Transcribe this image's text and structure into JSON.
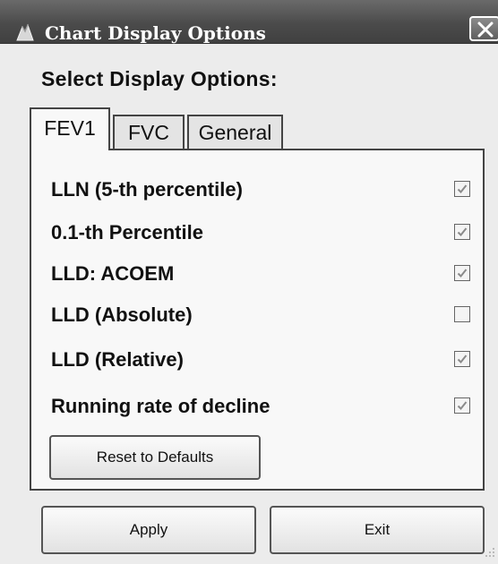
{
  "window": {
    "title": "Chart Display Options",
    "icon": "app-icon",
    "close_icon": "close-icon"
  },
  "heading": "Select Display Options:",
  "tabs": [
    {
      "label": "FEV1",
      "active": true
    },
    {
      "label": "FVC",
      "active": false
    },
    {
      "label": "General",
      "active": false
    }
  ],
  "options": [
    {
      "label": "LLN (5-th percentile)",
      "checked": true
    },
    {
      "label": "0.1-th Percentile",
      "checked": true
    },
    {
      "label": "LLD: ACOEM",
      "checked": true
    },
    {
      "label": "LLD (Absolute)",
      "checked": false
    },
    {
      "label": "LLD (Relative)",
      "checked": true
    },
    {
      "label": "Running rate of decline",
      "checked": true
    }
  ],
  "buttons": {
    "reset": "Reset to Defaults",
    "apply": "Apply",
    "exit": "Exit"
  }
}
